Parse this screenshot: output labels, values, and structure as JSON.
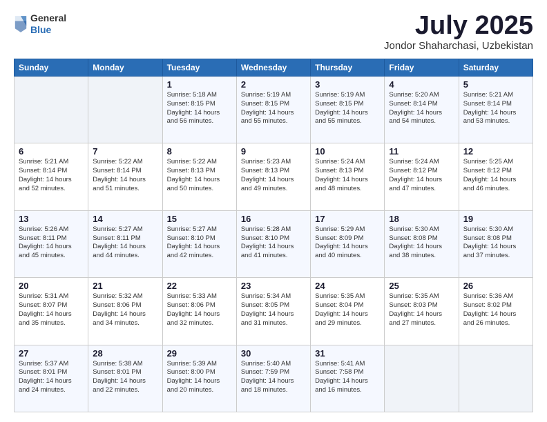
{
  "header": {
    "logo": {
      "general": "General",
      "blue": "Blue"
    },
    "title": "July 2025",
    "subtitle": "Jondor Shaharchasi, Uzbekistan"
  },
  "weekdays": [
    "Sunday",
    "Monday",
    "Tuesday",
    "Wednesday",
    "Thursday",
    "Friday",
    "Saturday"
  ],
  "weeks": [
    [
      {
        "day": "",
        "text": ""
      },
      {
        "day": "",
        "text": ""
      },
      {
        "day": "1",
        "text": "Sunrise: 5:18 AM\nSunset: 8:15 PM\nDaylight: 14 hours and 56 minutes."
      },
      {
        "day": "2",
        "text": "Sunrise: 5:19 AM\nSunset: 8:15 PM\nDaylight: 14 hours and 55 minutes."
      },
      {
        "day": "3",
        "text": "Sunrise: 5:19 AM\nSunset: 8:15 PM\nDaylight: 14 hours and 55 minutes."
      },
      {
        "day": "4",
        "text": "Sunrise: 5:20 AM\nSunset: 8:14 PM\nDaylight: 14 hours and 54 minutes."
      },
      {
        "day": "5",
        "text": "Sunrise: 5:21 AM\nSunset: 8:14 PM\nDaylight: 14 hours and 53 minutes."
      }
    ],
    [
      {
        "day": "6",
        "text": "Sunrise: 5:21 AM\nSunset: 8:14 PM\nDaylight: 14 hours and 52 minutes."
      },
      {
        "day": "7",
        "text": "Sunrise: 5:22 AM\nSunset: 8:14 PM\nDaylight: 14 hours and 51 minutes."
      },
      {
        "day": "8",
        "text": "Sunrise: 5:22 AM\nSunset: 8:13 PM\nDaylight: 14 hours and 50 minutes."
      },
      {
        "day": "9",
        "text": "Sunrise: 5:23 AM\nSunset: 8:13 PM\nDaylight: 14 hours and 49 minutes."
      },
      {
        "day": "10",
        "text": "Sunrise: 5:24 AM\nSunset: 8:13 PM\nDaylight: 14 hours and 48 minutes."
      },
      {
        "day": "11",
        "text": "Sunrise: 5:24 AM\nSunset: 8:12 PM\nDaylight: 14 hours and 47 minutes."
      },
      {
        "day": "12",
        "text": "Sunrise: 5:25 AM\nSunset: 8:12 PM\nDaylight: 14 hours and 46 minutes."
      }
    ],
    [
      {
        "day": "13",
        "text": "Sunrise: 5:26 AM\nSunset: 8:11 PM\nDaylight: 14 hours and 45 minutes."
      },
      {
        "day": "14",
        "text": "Sunrise: 5:27 AM\nSunset: 8:11 PM\nDaylight: 14 hours and 44 minutes."
      },
      {
        "day": "15",
        "text": "Sunrise: 5:27 AM\nSunset: 8:10 PM\nDaylight: 14 hours and 42 minutes."
      },
      {
        "day": "16",
        "text": "Sunrise: 5:28 AM\nSunset: 8:10 PM\nDaylight: 14 hours and 41 minutes."
      },
      {
        "day": "17",
        "text": "Sunrise: 5:29 AM\nSunset: 8:09 PM\nDaylight: 14 hours and 40 minutes."
      },
      {
        "day": "18",
        "text": "Sunrise: 5:30 AM\nSunset: 8:08 PM\nDaylight: 14 hours and 38 minutes."
      },
      {
        "day": "19",
        "text": "Sunrise: 5:30 AM\nSunset: 8:08 PM\nDaylight: 14 hours and 37 minutes."
      }
    ],
    [
      {
        "day": "20",
        "text": "Sunrise: 5:31 AM\nSunset: 8:07 PM\nDaylight: 14 hours and 35 minutes."
      },
      {
        "day": "21",
        "text": "Sunrise: 5:32 AM\nSunset: 8:06 PM\nDaylight: 14 hours and 34 minutes."
      },
      {
        "day": "22",
        "text": "Sunrise: 5:33 AM\nSunset: 8:06 PM\nDaylight: 14 hours and 32 minutes."
      },
      {
        "day": "23",
        "text": "Sunrise: 5:34 AM\nSunset: 8:05 PM\nDaylight: 14 hours and 31 minutes."
      },
      {
        "day": "24",
        "text": "Sunrise: 5:35 AM\nSunset: 8:04 PM\nDaylight: 14 hours and 29 minutes."
      },
      {
        "day": "25",
        "text": "Sunrise: 5:35 AM\nSunset: 8:03 PM\nDaylight: 14 hours and 27 minutes."
      },
      {
        "day": "26",
        "text": "Sunrise: 5:36 AM\nSunset: 8:02 PM\nDaylight: 14 hours and 26 minutes."
      }
    ],
    [
      {
        "day": "27",
        "text": "Sunrise: 5:37 AM\nSunset: 8:01 PM\nDaylight: 14 hours and 24 minutes."
      },
      {
        "day": "28",
        "text": "Sunrise: 5:38 AM\nSunset: 8:01 PM\nDaylight: 14 hours and 22 minutes."
      },
      {
        "day": "29",
        "text": "Sunrise: 5:39 AM\nSunset: 8:00 PM\nDaylight: 14 hours and 20 minutes."
      },
      {
        "day": "30",
        "text": "Sunrise: 5:40 AM\nSunset: 7:59 PM\nDaylight: 14 hours and 18 minutes."
      },
      {
        "day": "31",
        "text": "Sunrise: 5:41 AM\nSunset: 7:58 PM\nDaylight: 14 hours and 16 minutes."
      },
      {
        "day": "",
        "text": ""
      },
      {
        "day": "",
        "text": ""
      }
    ]
  ]
}
